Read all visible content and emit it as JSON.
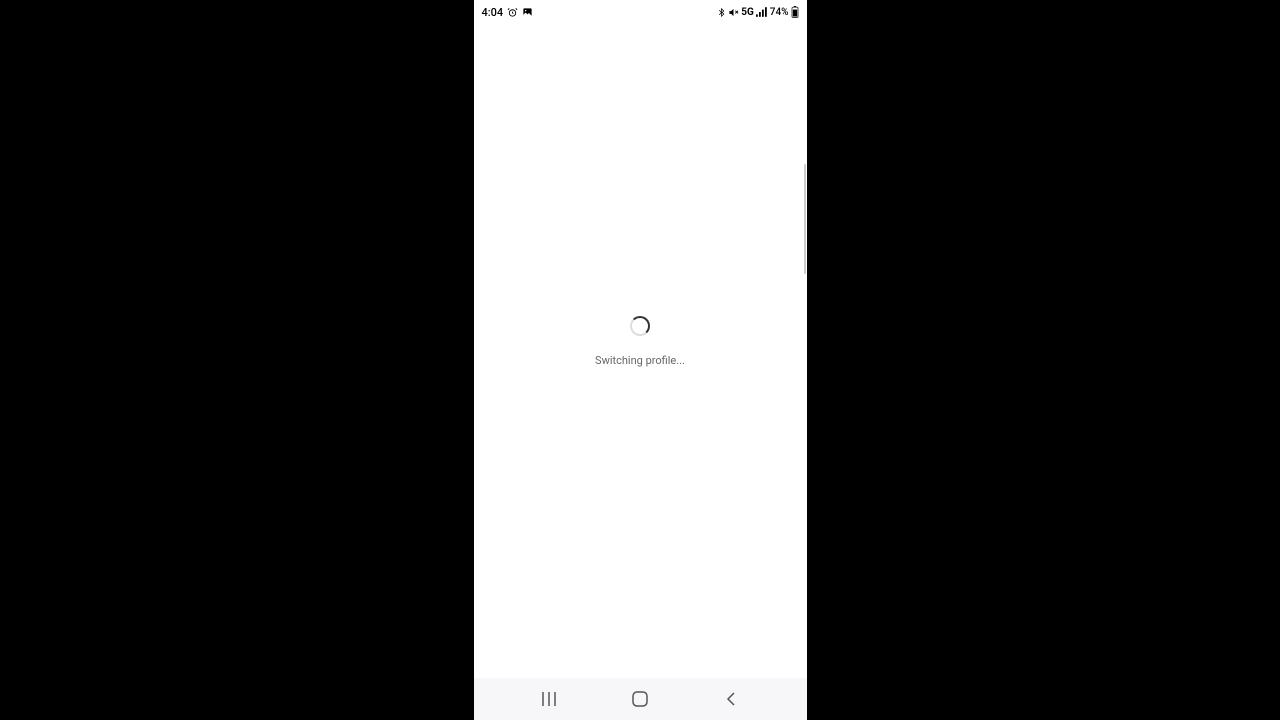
{
  "statusBar": {
    "time": "4:04",
    "network": "5G",
    "battery": "74%"
  },
  "loading": {
    "message": "Switching profile..."
  }
}
